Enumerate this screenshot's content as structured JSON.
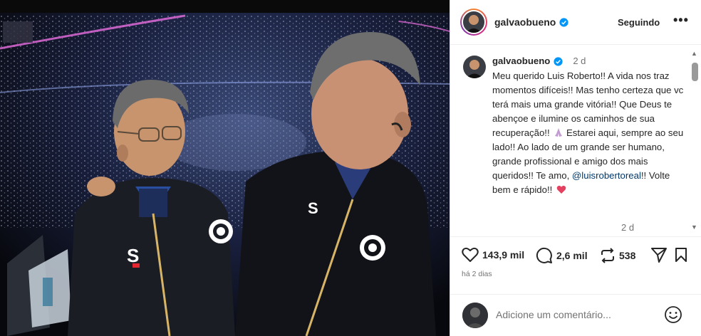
{
  "post": {
    "username": "galvaobueno",
    "follow_label": "Seguindo",
    "more_label": "•••"
  },
  "caption": {
    "username": "galvaobueno",
    "time": "2 d",
    "text_before_mention": "Meu querido Luis Roberto!! A vida nos traz momentos difíceis!! Mas tenho certeza que vc terá mais uma grande vitória!! Que Deus te abençoe e ilumine os caminhos de sua recuperação!!",
    "text_middle": " Estarei aqui, sempre ao seu lado!! Ao lado de um grande ser humano, grande profissional e amigo dos mais queridos!! Te amo, ",
    "mention": "@luisrobertoreal",
    "text_after_mention": "!! Volte bem e rápido!!",
    "emojis": [
      "praying-hands-emoji",
      "heart-emoji"
    ],
    "footer_time": "2 d"
  },
  "actions": {
    "likes": "143,9 mil",
    "comments": "2,6 mil",
    "reposts": "538",
    "time_ago": "há 2 dias"
  },
  "comment_box": {
    "placeholder": "Adicione um comentário..."
  },
  "icons": {
    "verified": "verified-badge-icon",
    "like": "heart-icon",
    "comment": "comment-icon",
    "repost": "repost-icon",
    "share": "send-icon",
    "save": "bookmark-icon",
    "emoji": "emoji-icon"
  },
  "colors": {
    "verified": "#0095f6",
    "mention": "#00376b",
    "heart_emoji": "#e4405f"
  }
}
